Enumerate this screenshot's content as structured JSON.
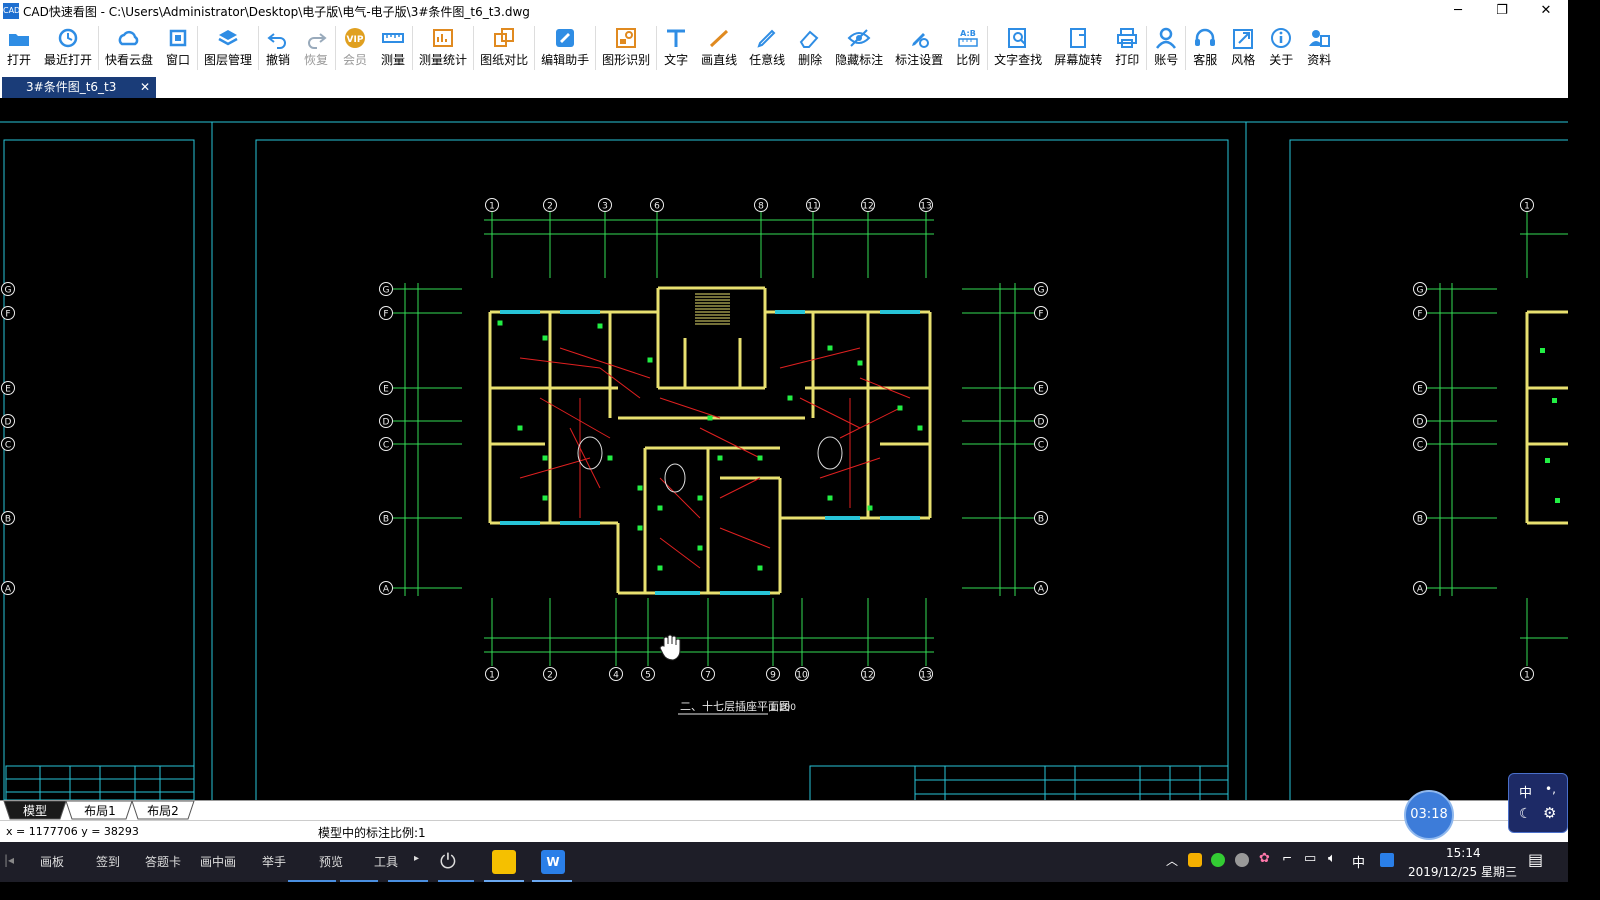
{
  "window": {
    "title": "CAD快速看图 - C:\\Users\\Administrator\\Desktop\\电子版\\电气-电子版\\3#条件图_t6_t3.dwg",
    "app_icon_text": "CAD",
    "minimize": "─",
    "restore": "❐",
    "close": "✕"
  },
  "toolbar": {
    "items": [
      {
        "label": "打开",
        "icon": "folder-open-icon",
        "color": "#2f8de4",
        "enabled": true
      },
      {
        "label": "最近打开",
        "icon": "history-icon",
        "color": "#2f8de4",
        "enabled": true
      },
      {
        "label": "快看云盘",
        "icon": "cloud-icon",
        "color": "#2f8de4",
        "enabled": true
      },
      {
        "label": "窗口",
        "icon": "window-icon",
        "color": "#2f8de4",
        "enabled": true
      },
      {
        "label": "图层管理",
        "icon": "layers-icon",
        "color": "#2f8de4",
        "enabled": true
      },
      {
        "label": "撤销",
        "icon": "undo-icon",
        "color": "#2f8de4",
        "enabled": true
      },
      {
        "label": "恢复",
        "icon": "redo-icon",
        "color": "#9ab",
        "enabled": false
      },
      {
        "label": "会员",
        "icon": "vip-icon",
        "color": "#e0a020",
        "enabled": false
      },
      {
        "label": "测量",
        "icon": "ruler-icon",
        "color": "#2f8de4",
        "enabled": true
      },
      {
        "label": "测量统计",
        "icon": "measure-stats-icon",
        "color": "#e08a20",
        "enabled": true
      },
      {
        "label": "图纸对比",
        "icon": "compare-icon",
        "color": "#e08a20",
        "enabled": true
      },
      {
        "label": "编辑助手",
        "icon": "edit-assistant-icon",
        "color": "#2f8de4",
        "enabled": true
      },
      {
        "label": "图形识别",
        "icon": "shape-recognition-icon",
        "color": "#e08a20",
        "enabled": true
      },
      {
        "label": "文字",
        "icon": "text-icon",
        "color": "#2f8de4",
        "enabled": true
      },
      {
        "label": "画直线",
        "icon": "line-icon",
        "color": "#e08a20",
        "enabled": true
      },
      {
        "label": "任意线",
        "icon": "pen-icon",
        "color": "#2f8de4",
        "enabled": true
      },
      {
        "label": "删除",
        "icon": "eraser-icon",
        "color": "#2f8de4",
        "enabled": true
      },
      {
        "label": "隐藏标注",
        "icon": "hide-annotation-icon",
        "color": "#2f8de4",
        "enabled": true
      },
      {
        "label": "标注设置",
        "icon": "annotation-settings-icon",
        "color": "#2f8de4",
        "enabled": true
      },
      {
        "label": "比例",
        "icon": "scale-icon",
        "color": "#2f8de4",
        "enabled": true
      },
      {
        "label": "文字查找",
        "icon": "text-search-icon",
        "color": "#2f8de4",
        "enabled": true
      },
      {
        "label": "屏幕旋转",
        "icon": "rotate-screen-icon",
        "color": "#2f8de4",
        "enabled": true
      },
      {
        "label": "打印",
        "icon": "printer-icon",
        "color": "#2f8de4",
        "enabled": true
      },
      {
        "label": "账号",
        "icon": "account-icon",
        "color": "#2f8de4",
        "enabled": true
      },
      {
        "label": "客服",
        "icon": "headset-icon",
        "color": "#2f8de4",
        "enabled": true
      },
      {
        "label": "风格",
        "icon": "style-icon",
        "color": "#2f8de4",
        "enabled": true
      },
      {
        "label": "关于",
        "icon": "info-icon",
        "color": "#2f8de4",
        "enabled": true
      },
      {
        "label": "资料",
        "icon": "resources-icon",
        "color": "#2f8de4",
        "enabled": true
      }
    ]
  },
  "document_tab": {
    "label": "3#条件图_t6_t3",
    "close": "✕"
  },
  "drawing": {
    "top_axes": [
      "1",
      "2",
      "3",
      "6",
      "8",
      "11",
      "12",
      "13"
    ],
    "bottom_axes": [
      "1",
      "2",
      "4",
      "5",
      "7",
      "9",
      "10",
      "12",
      "13"
    ],
    "row_axes": [
      "G",
      "F",
      "E",
      "D",
      "C",
      "B",
      "A"
    ],
    "plan_title": "二、十七层插座平面图",
    "plan_scale": "1:100",
    "colors": {
      "frame": "#27c4d8",
      "axis": "#33dd55",
      "wall": "#e8e070",
      "wire": "#e02020",
      "device": "#22ee44"
    }
  },
  "layout_tabs": [
    "模型",
    "布局1",
    "布局2"
  ],
  "status": {
    "coords": "x = 1177706  y = 38293",
    "scale_text": "模型中的标注比例:1"
  },
  "overlay": {
    "timer": "03:18"
  },
  "taskbar": {
    "items": [
      "画板",
      "签到",
      "答题卡",
      "画中画",
      "举手",
      "预览",
      "工具"
    ],
    "ime": "中",
    "time": "15:14",
    "date": "2019/12/25 星期三"
  }
}
